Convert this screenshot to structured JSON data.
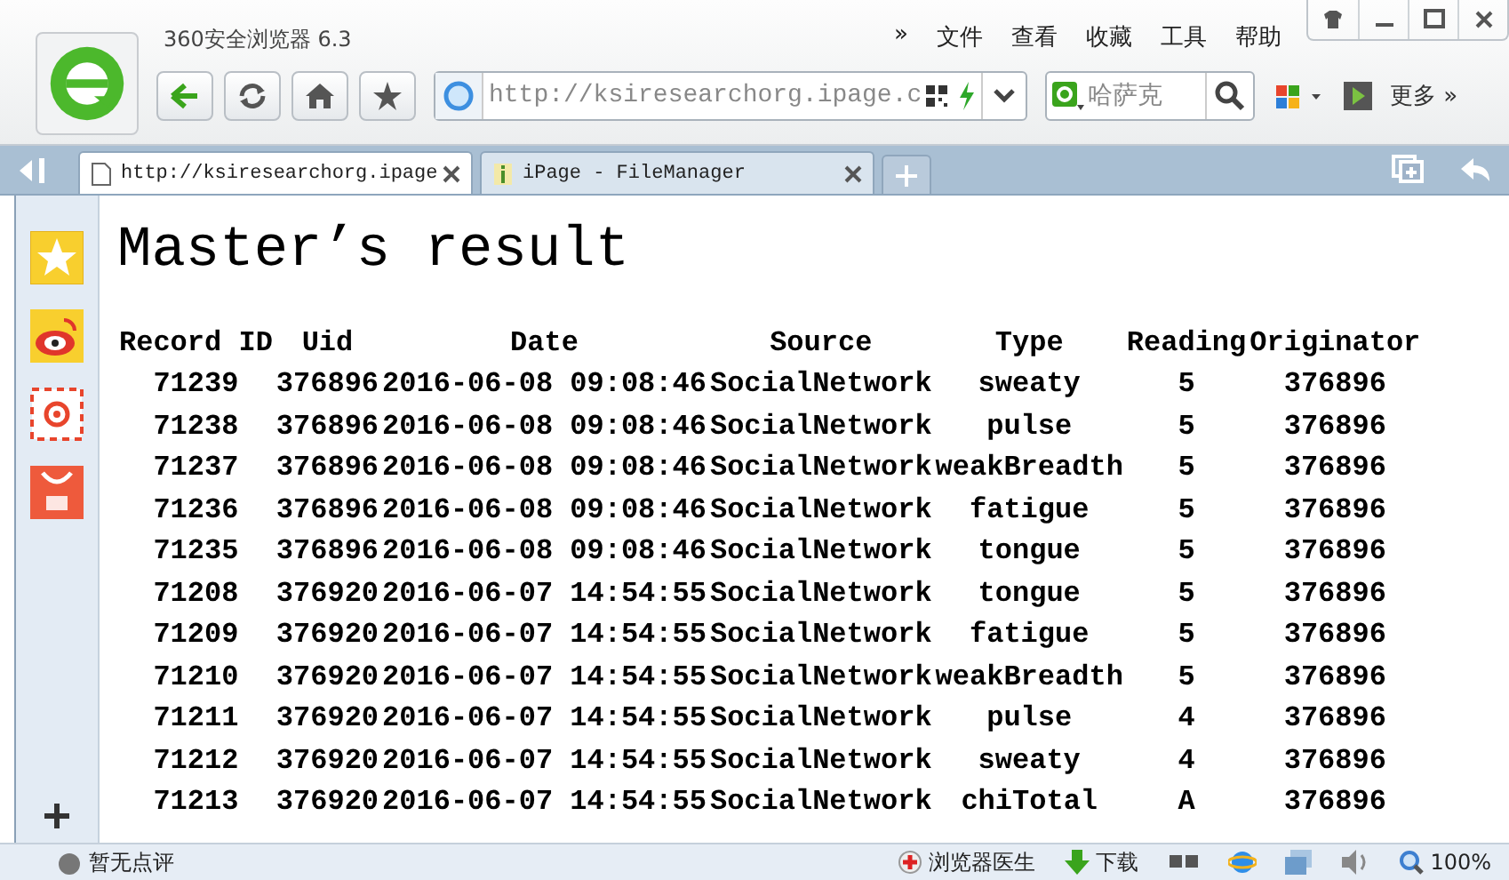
{
  "window": {
    "title": "360安全浏览器 6.3"
  },
  "menu": [
    {
      "label": "»"
    },
    {
      "label": "文件"
    },
    {
      "label": "查看"
    },
    {
      "label": "收藏"
    },
    {
      "label": "工具"
    },
    {
      "label": "帮助"
    }
  ],
  "address": {
    "value": "http://ksiresearchorg.ipage.c"
  },
  "search": {
    "value": "哈萨克"
  },
  "more": "更多 »",
  "tabs": [
    {
      "label": "http://ksiresearchorg.ipage",
      "selected": true
    },
    {
      "label": "iPage - FileManager",
      "selected": false
    }
  ],
  "page": {
    "heading": "Master’s result",
    "table": {
      "columns": [
        "Record ID",
        "Uid",
        "Date",
        "Source",
        "Type",
        "Reading",
        "Originator"
      ],
      "rows": [
        [
          "71239",
          "376896",
          "2016-06-08 09:08:46",
          "SocialNetwork",
          "sweaty",
          "5",
          "376896"
        ],
        [
          "71238",
          "376896",
          "2016-06-08 09:08:46",
          "SocialNetwork",
          "pulse",
          "5",
          "376896"
        ],
        [
          "71237",
          "376896",
          "2016-06-08 09:08:46",
          "SocialNetwork",
          "weakBreadth",
          "5",
          "376896"
        ],
        [
          "71236",
          "376896",
          "2016-06-08 09:08:46",
          "SocialNetwork",
          "fatigue",
          "5",
          "376896"
        ],
        [
          "71235",
          "376896",
          "2016-06-08 09:08:46",
          "SocialNetwork",
          "tongue",
          "5",
          "376896"
        ],
        [
          "71208",
          "376920",
          "2016-06-07 14:54:55",
          "SocialNetwork",
          "tongue",
          "5",
          "376896"
        ],
        [
          "71209",
          "376920",
          "2016-06-07 14:54:55",
          "SocialNetwork",
          "fatigue",
          "5",
          "376896"
        ],
        [
          "71210",
          "376920",
          "2016-06-07 14:54:55",
          "SocialNetwork",
          "weakBreadth",
          "5",
          "376896"
        ],
        [
          "71211",
          "376920",
          "2016-06-07 14:54:55",
          "SocialNetwork",
          "pulse",
          "4",
          "376896"
        ],
        [
          "71212",
          "376920",
          "2016-06-07 14:54:55",
          "SocialNetwork",
          "sweaty",
          "4",
          "376896"
        ],
        [
          "71213",
          "376920",
          "2016-06-07 14:54:55",
          "SocialNetwork",
          "chiTotal",
          "A",
          "376896"
        ]
      ]
    }
  },
  "status_bar": {
    "rating": "暂无点评",
    "doctor": "浏览器医生",
    "download": "下载",
    "zoom": "100%"
  }
}
